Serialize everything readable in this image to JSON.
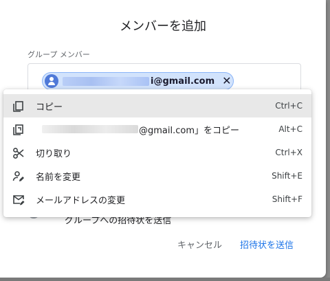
{
  "dialog": {
    "title": "メンバーを追加",
    "field_label": "グループ メンバー",
    "chip": {
      "email_visible": "i@gmail.com",
      "remove_icon": "close-icon"
    },
    "notify_label": "グループへの招待状を送信",
    "cancel_label": "キャンセル",
    "send_label": "招待状を送信",
    "accent": "#1a73e8"
  },
  "context_menu": {
    "items": [
      {
        "icon": "copy-icon",
        "label": "コピー",
        "shortcut": "Ctrl+C",
        "highlighted": true
      },
      {
        "icon": "copy-link-icon",
        "label": "@gmail.com」をコピー",
        "shortcut": "Alt+C",
        "highlighted": false
      },
      {
        "icon": "scissors-icon",
        "label": "切り取り",
        "shortcut": "Ctrl+X",
        "highlighted": false
      },
      {
        "icon": "person-edit-icon",
        "label": "名前を変更",
        "shortcut": "Shift+E",
        "highlighted": false
      },
      {
        "icon": "mail-edit-icon",
        "label": "メールアドレスの変更",
        "shortcut": "Shift+F",
        "highlighted": false
      }
    ]
  }
}
